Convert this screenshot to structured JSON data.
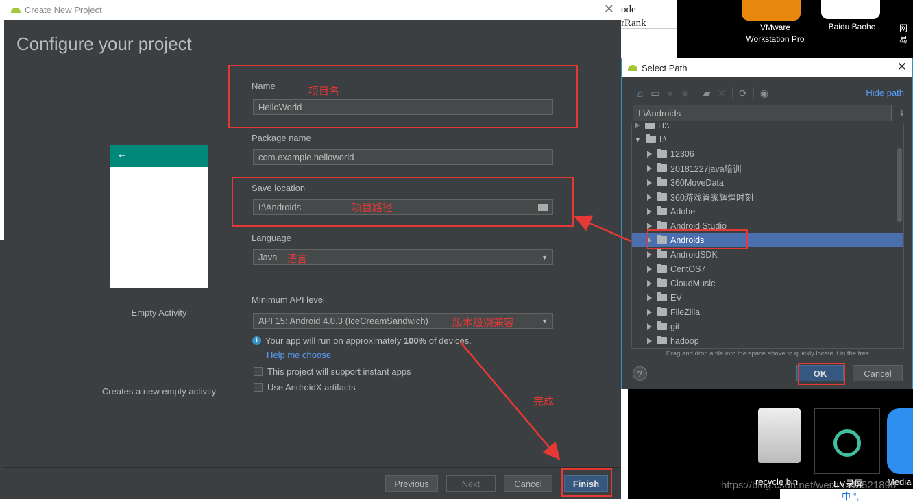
{
  "background": {
    "browser_text": [
      "ode",
      "rRank"
    ],
    "desktop_icons": [
      {
        "label": "VMware Workstation Pro"
      },
      {
        "label": "Baidu Baohe"
      },
      {
        "label": "网易"
      },
      {
        "label": "recycle bin"
      },
      {
        "label": "EV录屏"
      },
      {
        "label": "Media"
      }
    ],
    "watermark": "https://blog.csdn.net/weixin_43521890",
    "tray": [
      "中",
      "°,"
    ]
  },
  "create_dialog": {
    "title": "Create New Project",
    "heading": "Configure your project",
    "template": {
      "name": "Empty Activity",
      "description": "Creates a new empty activity"
    },
    "name_label": "Name",
    "name_value": "HelloWorld",
    "package_label": "Package name",
    "package_value": "com.example.helloworld",
    "location_label": "Save location",
    "location_value": "I:\\Androids",
    "language_label": "Language",
    "language_value": "Java",
    "api_label": "Minimum API level",
    "api_value": "API 15: Android 4.0.3 (IceCreamSandwich)",
    "info_prefix": "Your app will run on approximately ",
    "info_percent": "100%",
    "info_suffix": " of devices.",
    "help_link": "Help me choose",
    "instant_apps": {
      "label": "This project will support instant apps",
      "checked": false
    },
    "androidx": {
      "label": "Use AndroidX artifacts",
      "checked": false
    },
    "buttons": {
      "previous": "Previous",
      "next": "Next",
      "cancel": "Cancel",
      "finish": "Finish"
    }
  },
  "annotations": {
    "name": "项目名",
    "path": "项目路径",
    "language": "语言",
    "api": "版本级别兼容",
    "finish": "完成",
    "color": "#e53935"
  },
  "select_path": {
    "title": "Select Path",
    "hide_path": "Hide path",
    "path_value": "I:\\Androids",
    "tree_partial": "H:\\",
    "root": "I:\\",
    "items": [
      "12306",
      "20181227java培训",
      "360MoveData",
      "360游戏管家辉煌时刻",
      "Adobe",
      "Android Studio",
      "Androids",
      "AndroidSDK",
      "CentOS7",
      "CloudMusic",
      "EV",
      "FileZilla",
      "git",
      "hadoop"
    ],
    "selected": "Androids",
    "hint": "Drag and drop a file into the space above to quickly locate it in the tree",
    "ok": "OK",
    "cancel": "Cancel",
    "help": "?"
  },
  "colors": {
    "dark_bg": "#3c3f41",
    "selection": "#4b6eaf",
    "teal": "#00897b",
    "link": "#589df6"
  }
}
